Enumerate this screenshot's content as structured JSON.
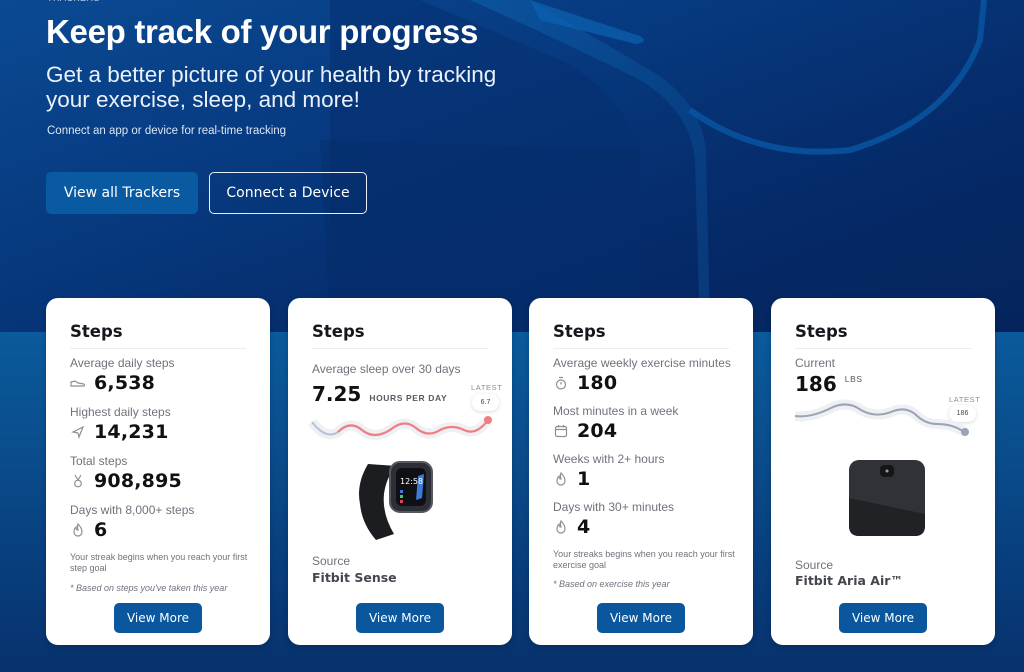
{
  "hero": {
    "eyebrow": "TRACKERS",
    "title": "Keep track of your progress",
    "subtitle": "Get a better picture of your health by tracking your exercise, sleep, and more!",
    "note": "Connect an app or device for real-time tracking",
    "primary_button": "View all Trackers",
    "secondary_button": "Connect a Device"
  },
  "colors": {
    "primary": "#0a5aa2",
    "hero_bg": "#073a80",
    "sleep_line": "#ef7d82",
    "weight_line": "#9aa4b2"
  },
  "cards": [
    {
      "title": "Steps",
      "stats": [
        {
          "label": "Average daily steps",
          "value": "6,538",
          "icon": "shoe-icon"
        },
        {
          "label": "Highest daily steps",
          "value": "14,231",
          "icon": "rocket-icon"
        },
        {
          "label": "Total steps",
          "value": "908,895",
          "icon": "medal-icon"
        },
        {
          "label": "Days with 8,000+ steps",
          "value": "6",
          "icon": "flame-icon"
        }
      ],
      "note": "Your streak begins when you reach your first step goal",
      "footnote": "* Based on steps you've taken this year",
      "button": "View More"
    },
    {
      "title": "Steps",
      "label": "Average sleep over 30 days",
      "value": "7.25",
      "unit": "HOURS PER DAY",
      "latest_label": "LATEST",
      "latest_value": "6.7",
      "source_label": "Source",
      "source_name": "Fitbit Sense",
      "watch_time": "12:58",
      "button": "View More"
    },
    {
      "title": "Steps",
      "stats": [
        {
          "label": "Average weekly exercise minutes",
          "value": "180",
          "icon": "stopwatch-icon"
        },
        {
          "label": "Most minutes in a week",
          "value": "204",
          "icon": "calendar-icon"
        },
        {
          "label": "Weeks with 2+ hours",
          "value": "1",
          "icon": "flame-icon"
        },
        {
          "label": "Days with 30+ minutes",
          "value": "4",
          "icon": "flame-icon"
        }
      ],
      "note": "Your streaks begins when you reach your first exercise goal",
      "footnote": "* Based on exercise this year",
      "button": "View More"
    },
    {
      "title": "Steps",
      "label": "Current",
      "value": "186",
      "unit": "LBS",
      "latest_label": "LATEST",
      "latest_value": "186",
      "source_label": "Source",
      "source_name": "Fitbit Aria Air™",
      "button": "View More"
    }
  ]
}
